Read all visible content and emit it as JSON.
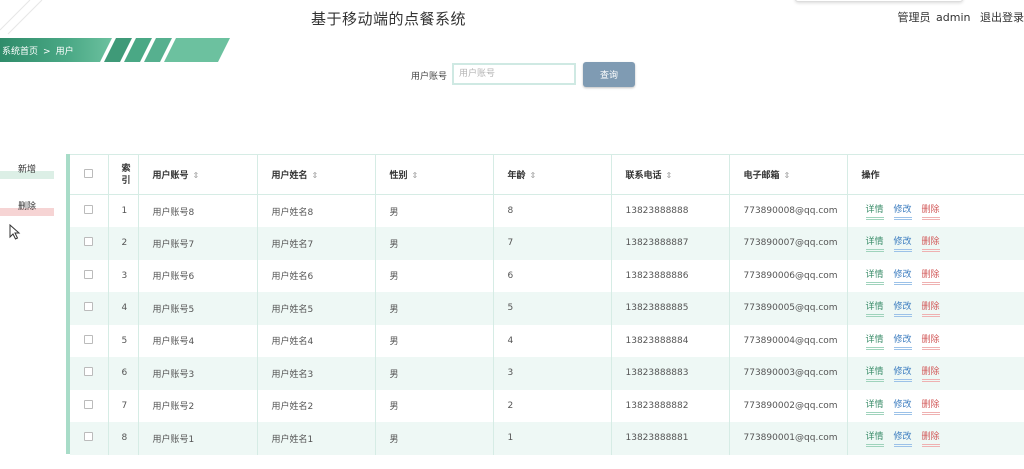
{
  "header": {
    "title": "基于移动端的点餐系统",
    "role": "管理员",
    "username": "admin",
    "logout": "退出登录"
  },
  "breadcrumb": {
    "home": "系统首页",
    "separator": ">",
    "current": "用户"
  },
  "search": {
    "label": "用户账号",
    "placeholder": "用户账号",
    "button": "查询"
  },
  "sidebar": {
    "add": "新增",
    "delete": "删除"
  },
  "table": {
    "columns": {
      "index": "索引",
      "account": "用户账号",
      "name": "用户姓名",
      "gender": "性别",
      "age": "年龄",
      "phone": "联系电话",
      "email": "电子邮箱",
      "ops": "操作"
    },
    "actions": {
      "detail": "详情",
      "edit": "修改",
      "delete": "删除"
    },
    "rows": [
      {
        "index": "1",
        "account": "用户账号8",
        "name": "用户姓名8",
        "gender": "男",
        "age": "8",
        "phone": "13823888888",
        "email": "773890008@qq.com"
      },
      {
        "index": "2",
        "account": "用户账号7",
        "name": "用户姓名7",
        "gender": "男",
        "age": "7",
        "phone": "13823888887",
        "email": "773890007@qq.com"
      },
      {
        "index": "3",
        "account": "用户账号6",
        "name": "用户姓名6",
        "gender": "男",
        "age": "6",
        "phone": "13823888886",
        "email": "773890006@qq.com"
      },
      {
        "index": "4",
        "account": "用户账号5",
        "name": "用户姓名5",
        "gender": "男",
        "age": "5",
        "phone": "13823888885",
        "email": "773890005@qq.com"
      },
      {
        "index": "5",
        "account": "用户账号4",
        "name": "用户姓名4",
        "gender": "男",
        "age": "4",
        "phone": "13823888884",
        "email": "773890004@qq.com"
      },
      {
        "index": "6",
        "account": "用户账号3",
        "name": "用户姓名3",
        "gender": "男",
        "age": "3",
        "phone": "13823888883",
        "email": "773890003@qq.com"
      },
      {
        "index": "7",
        "account": "用户账号2",
        "name": "用户姓名2",
        "gender": "男",
        "age": "2",
        "phone": "13823888882",
        "email": "773890002@qq.com"
      },
      {
        "index": "8",
        "account": "用户账号1",
        "name": "用户姓名1",
        "gender": "男",
        "age": "1",
        "phone": "13823888881",
        "email": "773890001@qq.com"
      }
    ]
  },
  "colors": {
    "accent": "#3f9a78",
    "search_button": "#7f9bb3",
    "row_alt": "#eef8f5"
  }
}
